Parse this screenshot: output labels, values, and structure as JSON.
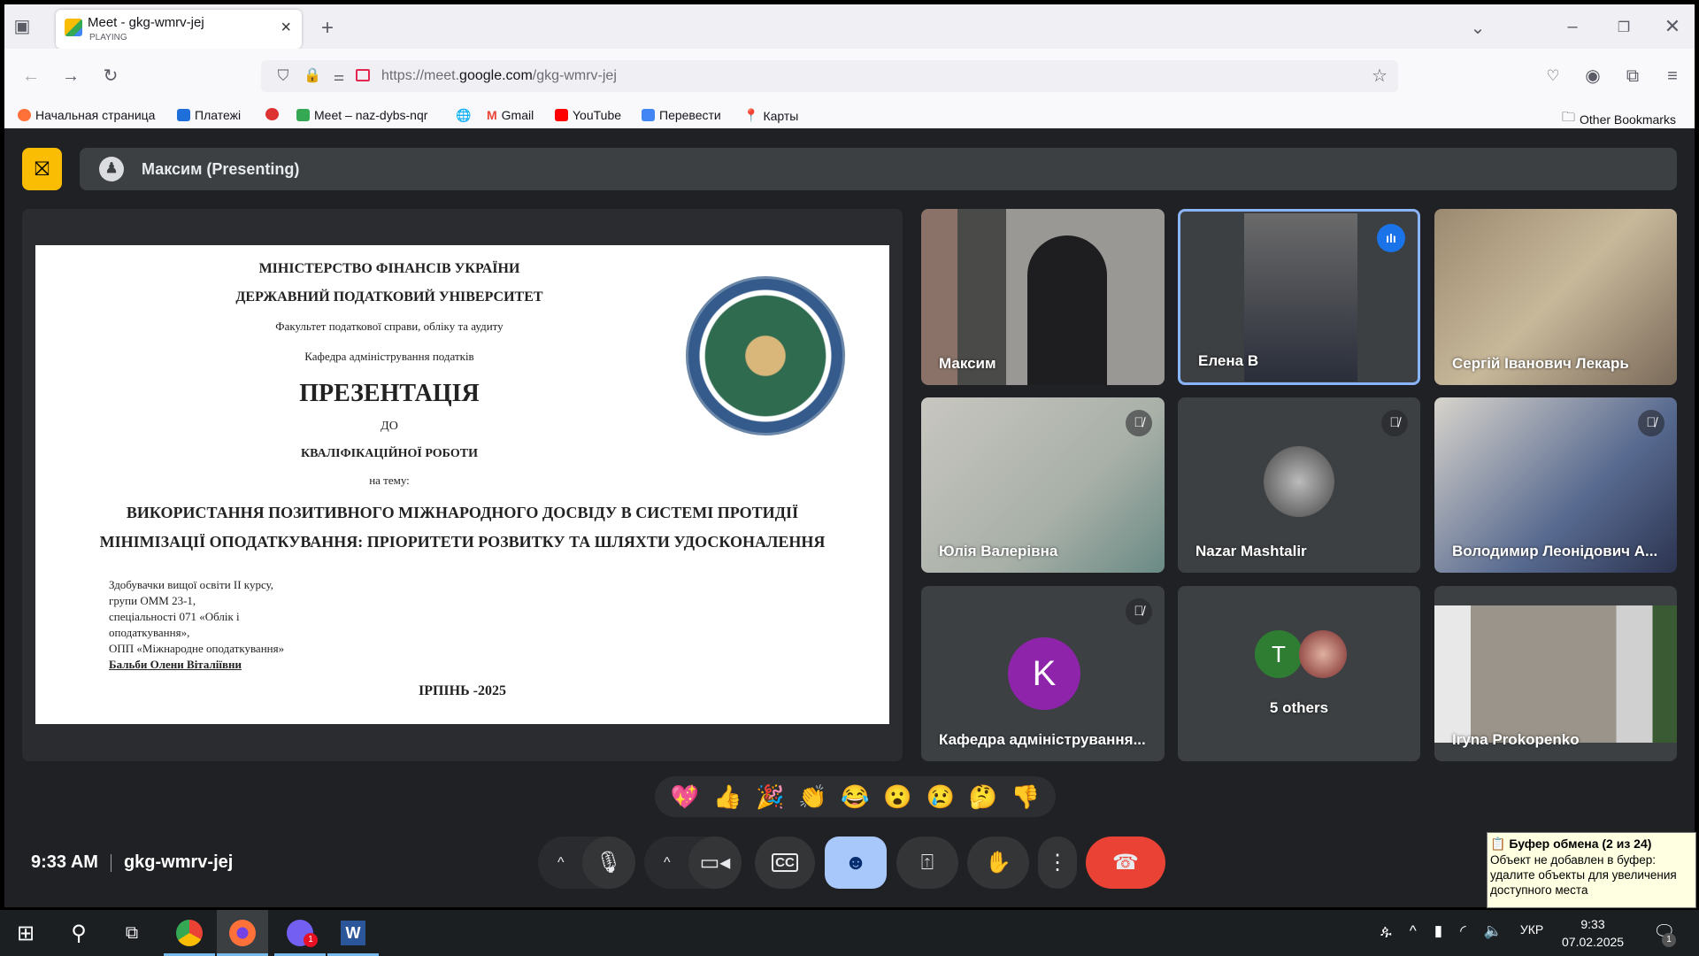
{
  "browser": {
    "tab_title": "Meet - gkg-wmrv-jej",
    "tab_status": "PLAYING",
    "url_prefix": "https://meet.",
    "url_domain": "google.com",
    "url_path": "/gkg-wmrv-jej",
    "bookmarks": [
      "Начальная страница",
      "Платежі",
      "",
      "Meet – naz-dybs-nqr",
      "",
      "Gmail",
      "YouTube",
      "Перевести",
      "Карты"
    ],
    "other_bookmarks": "Other Bookmarks"
  },
  "meet": {
    "presenter_bar": "Максим (Presenting)",
    "meeting_time": "9:33 AM",
    "meeting_code": "gkg-wmrv-jej",
    "slide": {
      "l1": "МІНІСТЕРСТВО ФІНАНСІВ УКРАЇНИ",
      "l2": "ДЕРЖАВНИЙ ПОДАТКОВИЙ УНІВЕРСИТЕТ",
      "l3": "Факультет податкової справи, обліку та аудиту",
      "l4": "Кафедра адміністрування податків",
      "l5": "ПРЕЗЕНТАЦІЯ",
      "l6": "ДО",
      "l7": "КВАЛІФІКАЦІЙНОЇ РОБОТИ",
      "l8": "на тему:",
      "l9": "ВИКОРИСТАННЯ ПОЗИТИВНОГО МІЖНАРОДНОГО ДОСВІДУ В СИСТЕМІ ПРОТИДІЇ",
      "l10": "МІНІМІЗАЦІЇ ОПОДАТКУВАННЯ: ПРІОРИТЕТИ РОЗВИТКУ ТА ШЛЯХТИ УДОСКОНАЛЕННЯ",
      "author": [
        "Здобувачки вищої освіти ІІ курсу,",
        "групи ОММ 23-1,",
        "спеціальності 071 «Облік і",
        "оподаткування»,",
        "ОПП «Міжнародне оподаткування»"
      ],
      "author_name": "Бальби Олени Віталіївни",
      "city_year": "ІРПІНЬ -2025"
    },
    "participants": [
      {
        "name": "Максим",
        "muted": false
      },
      {
        "name": "Елена В",
        "muted": false,
        "speaking": true
      },
      {
        "name": "Сергій Іванович Лекарь",
        "muted": false
      },
      {
        "name": "Юлія Валерівна",
        "muted": true
      },
      {
        "name": "Nazar Mashtalir",
        "muted": true
      },
      {
        "name": "Володимир Леонідович А...",
        "muted": true
      },
      {
        "name": "Кафедра адміністрування...",
        "muted": true,
        "initial": "K",
        "color": "#8e24aa"
      },
      {
        "name": "5 others",
        "initial": "T",
        "color": "#2e7d32"
      },
      {
        "name": "Iryna Prokopenko",
        "muted": false
      }
    ],
    "reactions": [
      "💖",
      "👍",
      "🎉",
      "👏",
      "😂",
      "😮",
      "😢",
      "🤔",
      "👎"
    ]
  },
  "taskbar": {
    "time": "9:33",
    "date": "07.02.2025",
    "lang": "УКР",
    "notifications": "1",
    "viber_badge": "1"
  },
  "clipboard_tip": {
    "title": "Буфер обмена (2 из 24)",
    "body": "Объект не добавлен в буфер: удалите объекты для увеличения доступного места"
  }
}
